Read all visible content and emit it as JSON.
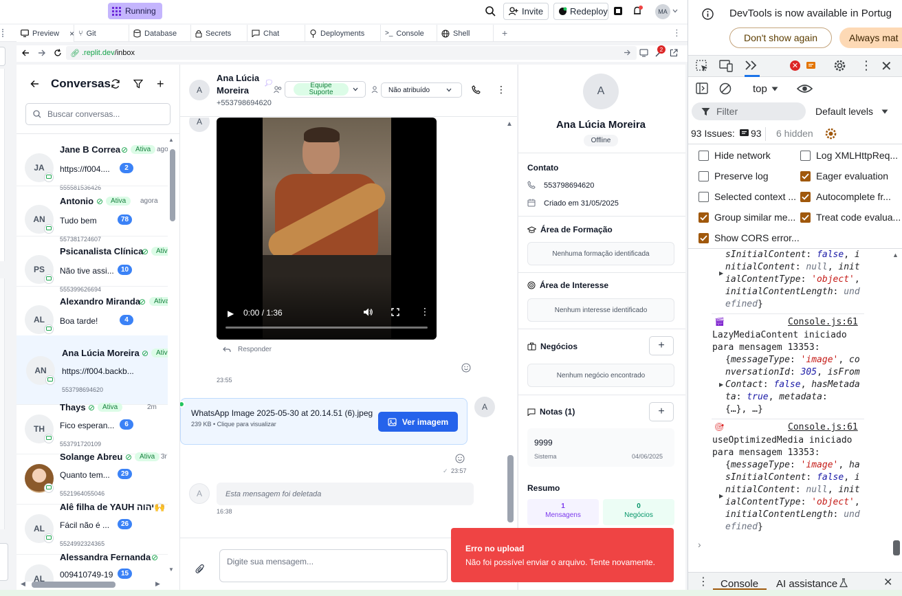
{
  "topbar": {
    "running_label": "Running",
    "invite_label": "Invite",
    "redeploy_label": "Redeploy",
    "user_initials": "MA"
  },
  "tabs": [
    {
      "label": "Preview"
    },
    {
      "label": "Git"
    },
    {
      "label": "Database"
    },
    {
      "label": "Secrets"
    },
    {
      "label": "Chat"
    },
    {
      "label": "Deployments"
    },
    {
      "label": "Console"
    },
    {
      "label": "Shell"
    }
  ],
  "urlbar": {
    "host": ".replit.dev",
    "path": "/inbox",
    "notif_count": "2"
  },
  "conv_panel": {
    "title": "Conversas",
    "search_placeholder": "Buscar conversas...",
    "items": [
      {
        "initials": "JA",
        "name": "Jane B Correa",
        "status": "Ativa",
        "time": "agora",
        "message": "https://f004....",
        "unread": "2",
        "phone": "555581536426"
      },
      {
        "initials": "AN",
        "name": "Antonio",
        "status": "Ativa",
        "time": "agora",
        "message": "Tudo bem",
        "unread": "78",
        "phone": "557381724607"
      },
      {
        "initials": "PS",
        "name": "Psicanalista Clínica",
        "status": "Ativa",
        "time": "",
        "message": "Não tive assi...",
        "unread": "10",
        "phone": "555399626694"
      },
      {
        "initials": "AL",
        "name": "Alexandro Miranda",
        "status": "Ativa",
        "time": "",
        "message": "Boa tarde!",
        "unread": "4",
        "phone": ""
      },
      {
        "initials": "AN",
        "name": "Ana Lúcia Moreira",
        "status": "Ativa",
        "time": "",
        "message": "https://f004.backb...",
        "unread": "",
        "phone": "553798694620"
      },
      {
        "initials": "TH",
        "name": "Thays",
        "status": "Ativa",
        "time": "2m",
        "message": "Fico esperan...",
        "unread": "6",
        "phone": "553791720109"
      },
      {
        "initials": "",
        "name": "Solange Abreu",
        "status": "Ativa",
        "time": "3r",
        "message": "Quanto tem...",
        "unread": "29",
        "phone": "5521964055046"
      },
      {
        "initials": "AL",
        "name": "Alê filha de YAUH יהוה🙌",
        "status": "",
        "time": "",
        "message": "Fácil não é ...",
        "unread": "26",
        "phone": "5524992324365"
      },
      {
        "initials": "AL",
        "name": "Alessandra Fernanda",
        "status": "",
        "time": "",
        "message": "009410749-19",
        "unread": "15",
        "phone": ""
      }
    ]
  },
  "chat": {
    "contact_initial": "A",
    "contact_name_line1": "Ana Lúcia",
    "contact_name_line2": "Moreira",
    "contact_phone": "+553798694620",
    "team_label": "Equipe Suporte",
    "assign_label": "Não atribuído",
    "video_time": "0:00 / 1:36",
    "reply_label": "Responder",
    "msg1_time": "23:55",
    "file_name": "WhatsApp Image 2025-05-30 at 20.14.51 (6).jpeg",
    "file_meta": "239 KB • Clique para visualizar",
    "view_image_label": "Ver imagem",
    "msg2_time": "23:57",
    "deleted_text": "Esta mensagem foi deletada",
    "deleted_time": "16:38",
    "input_placeholder": "Digite sua mensagem...",
    "out_initial": "A"
  },
  "details": {
    "initial": "A",
    "name": "Ana Lúcia Moreira",
    "status": "Offline",
    "contact_title": "Contato",
    "phone": "553798694620",
    "created": "Criado em 31/05/2025",
    "formation_title": "Área de Formação",
    "formation_empty": "Nenhuma formação identificada",
    "interest_title": "Área de Interesse",
    "interest_empty": "Nenhum interesse identificado",
    "business_title": "Negócios",
    "business_empty": "Nenhum negócio encontrado",
    "notes_title": "Notas (1)",
    "note_text": "9999",
    "note_author": "Sistema",
    "note_date": "04/06/2025",
    "summary_title": "Resumo",
    "messages_count": "1",
    "messages_label": "Mensagens",
    "business_count": "0",
    "business_label": "Negócios"
  },
  "toast": {
    "title": "Erro no upload",
    "message": "Não foi possível enviar o arquivo. Tente novamente."
  },
  "devtools": {
    "banner_text": "DevTools is now available in Portug",
    "dont_show": "Don't show again",
    "always": "Always mat",
    "context": "top",
    "filter_placeholder": "Filter",
    "levels": "Default levels",
    "issues_label": "93 Issues:",
    "issues_count": "93",
    "hidden": "6 hidden",
    "checkboxes": [
      {
        "label": "Hide network",
        "checked": false
      },
      {
        "label": "Log XMLHttpReq...",
        "checked": false
      },
      {
        "label": "Preserve log",
        "checked": false
      },
      {
        "label": "Eager evaluation",
        "checked": true
      },
      {
        "label": "Selected context ...",
        "checked": false
      },
      {
        "label": "Autocomplete fr...",
        "checked": true
      },
      {
        "label": "Group similar me...",
        "checked": true
      },
      {
        "label": "Treat code evalua...",
        "checked": true
      },
      {
        "label": "Show CORS error...",
        "checked": true
      }
    ],
    "source1": "Console.js:61",
    "source2": "Console.js:61",
    "log1_title": "LazyMediaContent iniciado",
    "log1_sub": "para mensagem 13353:",
    "log2_title": "useOptimizedMedia iniciado",
    "log2_sub": "para mensagem 13353:",
    "drawer_console": "Console",
    "drawer_ai": "AI assistance"
  }
}
